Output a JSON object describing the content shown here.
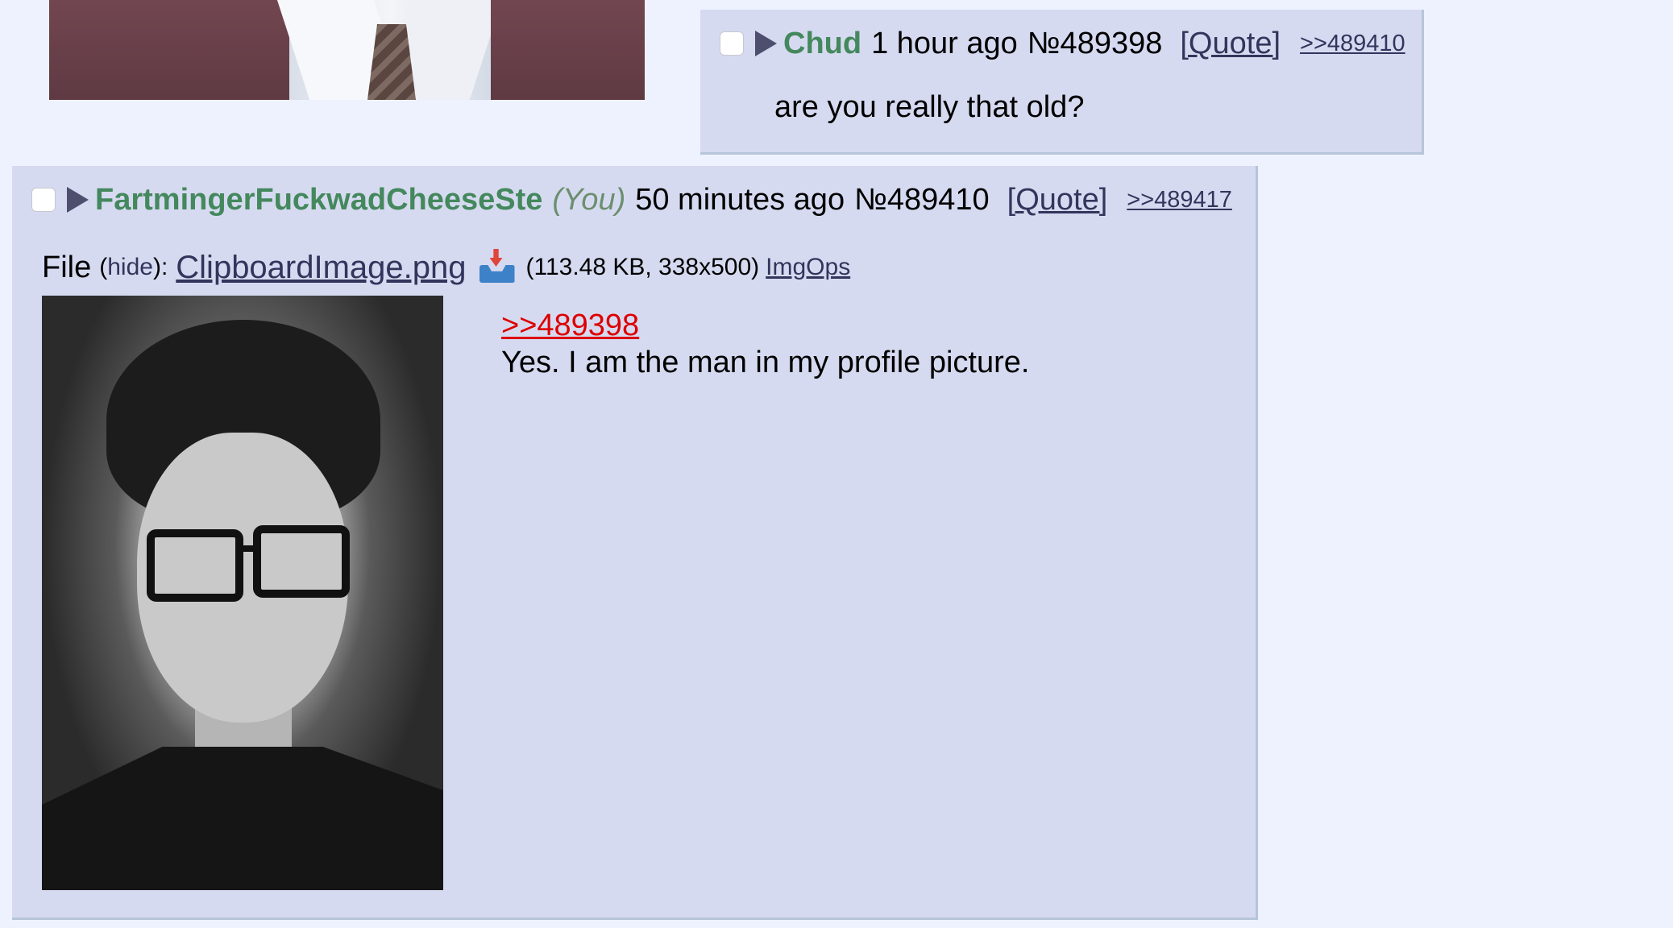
{
  "top_post_image": {
    "alt": ""
  },
  "posts": [
    {
      "name": "Chud",
      "time": "1 hour ago",
      "number": "№489398",
      "quote_label": "[Quote]",
      "backlinks": [
        ">>489410"
      ],
      "message": "are you really that old?"
    },
    {
      "name": "FartmingerFuckwadCheeseSte",
      "you_label": "(You)",
      "time": "50 minutes ago",
      "number": "№489410",
      "quote_label": "[Quote]",
      "backlinks": [
        ">>489417"
      ],
      "file": {
        "label": "File",
        "hide_open": "(",
        "hide_label": "hide",
        "hide_close": "):",
        "filename": "ClipboardImage.png",
        "meta": "(113.48 KB, 338x500)",
        "imgops_label": "ImgOps"
      },
      "quote_ref": ">>489398",
      "message": "Yes. I am the man in my profile picture."
    }
  ]
}
